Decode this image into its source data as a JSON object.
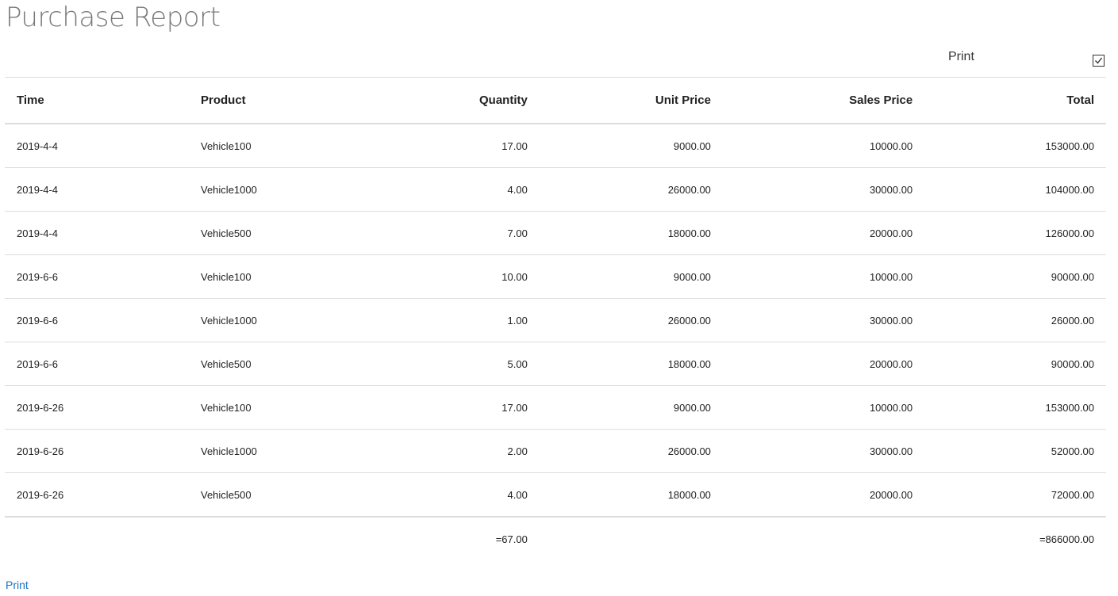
{
  "page": {
    "title": "Purchase Report"
  },
  "print_toggle": {
    "label": "Print",
    "checked": true
  },
  "table": {
    "headers": [
      "Time",
      "Product",
      "Quantity",
      "Unit Price",
      "Sales Price",
      "Total"
    ],
    "rows": [
      [
        "2019-4-4",
        "Vehicle100",
        "17.00",
        "9000.00",
        "10000.00",
        "153000.00"
      ],
      [
        "2019-4-4",
        "Vehicle1000",
        "4.00",
        "26000.00",
        "30000.00",
        "104000.00"
      ],
      [
        "2019-4-4",
        "Vehicle500",
        "7.00",
        "18000.00",
        "20000.00",
        "126000.00"
      ],
      [
        "2019-6-6",
        "Vehicle100",
        "10.00",
        "9000.00",
        "10000.00",
        "90000.00"
      ],
      [
        "2019-6-6",
        "Vehicle1000",
        "1.00",
        "26000.00",
        "30000.00",
        "26000.00"
      ],
      [
        "2019-6-6",
        "Vehicle500",
        "5.00",
        "18000.00",
        "20000.00",
        "90000.00"
      ],
      [
        "2019-6-26",
        "Vehicle100",
        "17.00",
        "9000.00",
        "10000.00",
        "153000.00"
      ],
      [
        "2019-6-26",
        "Vehicle1000",
        "2.00",
        "26000.00",
        "30000.00",
        "52000.00"
      ],
      [
        "2019-6-26",
        "Vehicle500",
        "4.00",
        "18000.00",
        "20000.00",
        "72000.00"
      ]
    ],
    "totals": {
      "quantity": "=67.00",
      "total": "=866000.00"
    }
  },
  "footer": {
    "print_link": "Print"
  },
  "colors": {
    "title": "#7a7a7a",
    "link": "#1a73c8",
    "border": "#dddddd"
  }
}
